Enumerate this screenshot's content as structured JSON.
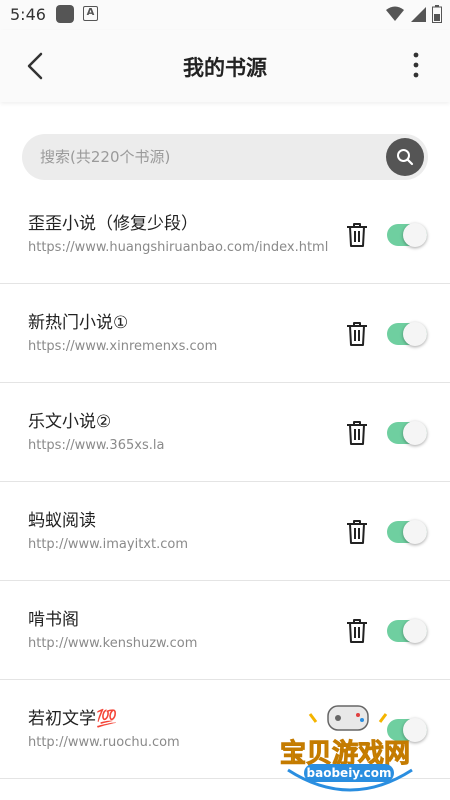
{
  "status_bar": {
    "time": "5:46",
    "icons": [
      "square-icon",
      "a-icon",
      "wifi-icon",
      "signal-icon",
      "battery-icon"
    ]
  },
  "app_bar": {
    "title": "我的书源",
    "back_icon": "back-arrow-icon",
    "more_icon": "more-vertical-icon"
  },
  "search": {
    "placeholder": "搜索(共220个书源)",
    "icon": "search-icon"
  },
  "sources": [
    {
      "name": "歪歪小说（修复少段）",
      "url": "https://www.huangshiruanbao.com/index.html",
      "enabled": true
    },
    {
      "name": "新热门小说①",
      "url": "https://www.xinremenxs.com",
      "enabled": true
    },
    {
      "name": "乐文小说②",
      "url": "https://www.365xs.la",
      "enabled": true
    },
    {
      "name": "蚂蚁阅读",
      "url": "http://www.imayitxt.com",
      "enabled": true
    },
    {
      "name": "啃书阁",
      "url": "http://www.kenshuzw.com",
      "enabled": true
    },
    {
      "name": "若初文学💯",
      "url": "http://www.ruochu.com",
      "enabled": true
    }
  ],
  "colors": {
    "toggle_on": "#6fcfa0",
    "search_button": "#555555",
    "search_bg": "#ececec"
  },
  "watermark": {
    "text": "宝贝游戏网",
    "domain": "baobeiy.com"
  }
}
